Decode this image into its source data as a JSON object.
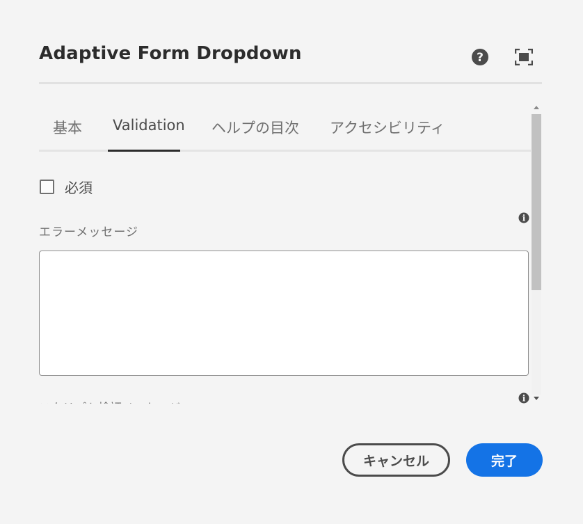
{
  "dialog": {
    "title": "Adaptive Form Dropdown"
  },
  "header": {
    "help_icon": "help-circle-icon",
    "fullscreen_icon": "fullscreen-icon"
  },
  "tabs": [
    {
      "label": "基本",
      "selected": false
    },
    {
      "label": "Validation",
      "selected": true
    },
    {
      "label": "ヘルプの目次",
      "selected": false
    },
    {
      "label": "アクセシビリティ",
      "selected": false
    }
  ],
  "validation": {
    "required_label": "必須",
    "required_checked": false,
    "error_message_label": "エラーメッセージ",
    "error_message_value": "",
    "next_field_label_partial": "スクリプト検証メッセージ"
  },
  "footer": {
    "cancel_label": "キャンセル",
    "done_label": "完了"
  },
  "colors": {
    "accent": "#1473e6",
    "background": "#f4f4f4",
    "text_dark": "#2c2c2c",
    "text_muted": "#707070"
  }
}
